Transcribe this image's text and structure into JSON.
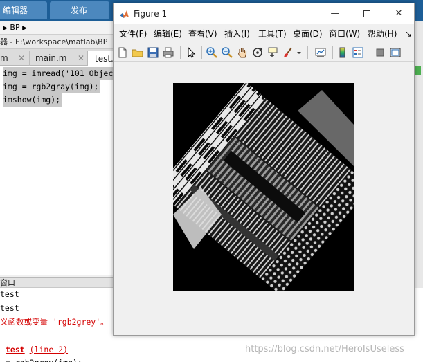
{
  "matlab": {
    "top_tabs": [
      "编辑器",
      "发布"
    ],
    "bp_label": "BP",
    "path_text": "器 - E:\\workspace\\matlab\\BP",
    "editor_tabs": [
      "m",
      "main.m",
      "test.m"
    ],
    "code_lines": [
      "img = imread('101_Objec",
      "img = rgb2gray(img);",
      "imshow(img);"
    ],
    "command_window_label": "窗口",
    "command_lines": {
      "line1": "test",
      "line2": "test",
      "line3": "义函数或变量 'rgb2grey'。",
      "err_func": "test",
      "err_line": "(line 2)",
      "line6": "= rgb2grey(img);"
    },
    "watermark": "https://blog.csdn.net/HeroIsUseless"
  },
  "figure": {
    "title": "Figure 1",
    "menu": [
      "文件(F)",
      "编辑(E)",
      "查看(V)",
      "插入(I)",
      "工具(T)",
      "桌面(D)",
      "窗口(W)",
      "帮助(H)"
    ],
    "menu_overflow": "↘",
    "accent_title_bar": "#1d5e97",
    "toolbar_icons": [
      "new-figure-icon",
      "open-file-icon",
      "save-icon",
      "print-icon",
      "pointer-icon",
      "zoom-in-icon",
      "zoom-out-icon",
      "pan-hand-icon",
      "rotate-3d-icon",
      "data-cursor-icon",
      "brush-icon",
      "link-plot-icon",
      "colorbar-icon",
      "legend-icon",
      "hide-plot-tools-icon",
      "show-plot-tools-icon"
    ]
  }
}
